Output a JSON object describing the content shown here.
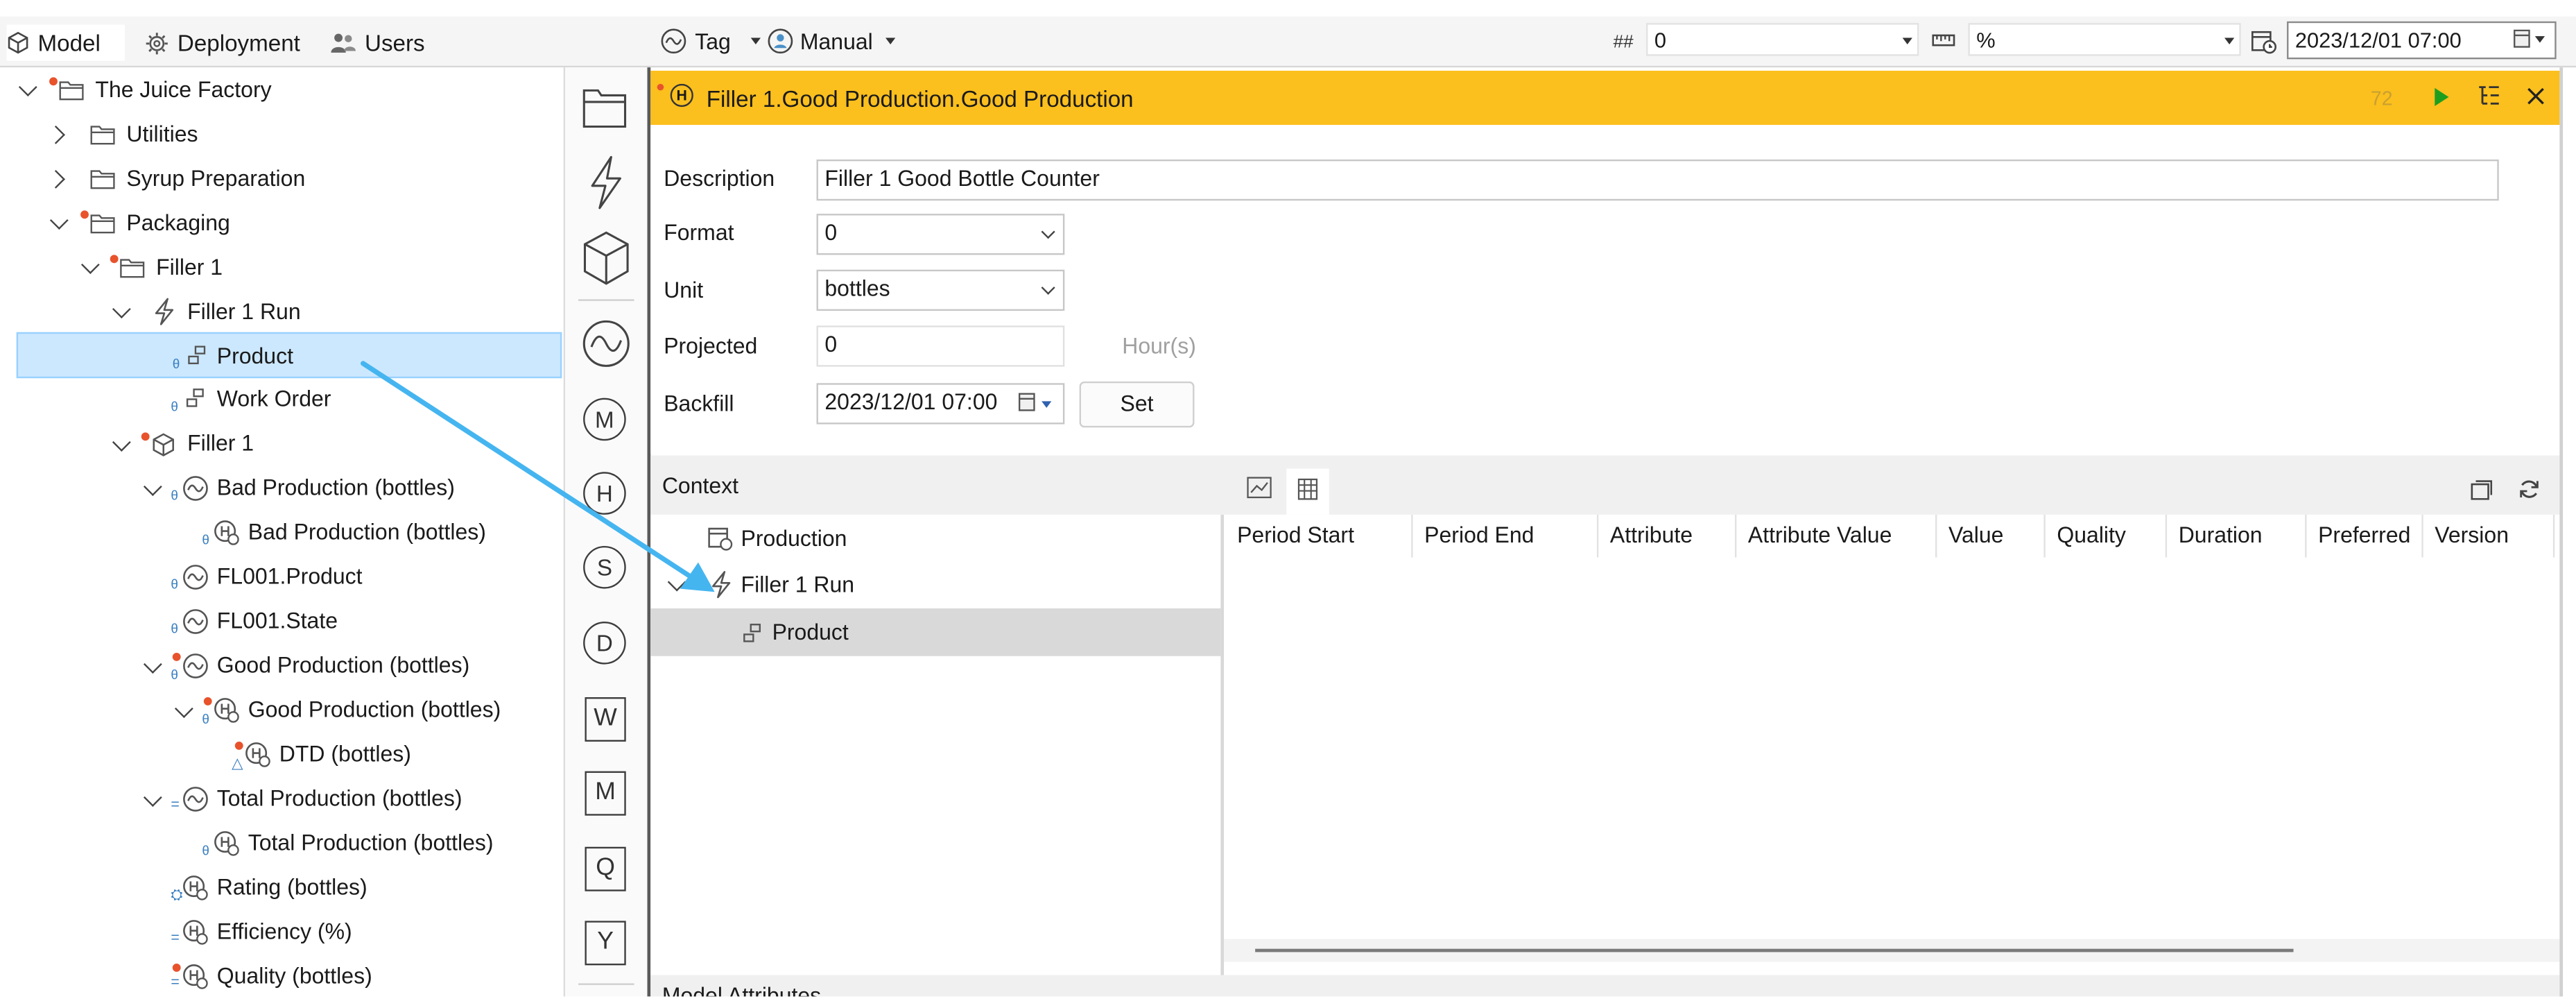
{
  "nav": {
    "tabs": [
      {
        "label": "Model",
        "icon": "cube-icon",
        "active": true
      },
      {
        "label": "Deployment",
        "icon": "gear-icon",
        "active": false
      },
      {
        "label": "Users",
        "icon": "users-icon",
        "active": false
      }
    ]
  },
  "toolbar": {
    "tag_label": "Tag",
    "manual_label": "Manual",
    "format_symbol": "##",
    "format_value": "0",
    "unit_value": "%",
    "datetime_value": "2023/12/01 07:00"
  },
  "tree": {
    "items": [
      {
        "label": "The Juice Factory",
        "icon": "folder-icon"
      },
      {
        "label": "Utilities",
        "icon": "folder-icon"
      },
      {
        "label": "Syrup Preparation",
        "icon": "folder-icon"
      },
      {
        "label": "Packaging",
        "icon": "folder-icon"
      },
      {
        "label": "Filler 1",
        "icon": "folder-icon"
      },
      {
        "label": "Filler 1 Run",
        "icon": "lightning-icon"
      },
      {
        "label": "Product",
        "icon": "attribute-icon"
      },
      {
        "label": "Work Order",
        "icon": "attribute-icon"
      },
      {
        "label": "Filler 1",
        "icon": "asset-icon"
      },
      {
        "label": "Bad Production (bottles)",
        "icon": "wave-icon"
      },
      {
        "label": "Bad Production (bottles)",
        "icon": "history-icon"
      },
      {
        "label": "FL001.Product",
        "icon": "wave-icon"
      },
      {
        "label": "FL001.State",
        "icon": "wave-icon"
      },
      {
        "label": "Good Production (bottles)",
        "icon": "wave-icon"
      },
      {
        "label": "Good Production (bottles)",
        "icon": "history-icon"
      },
      {
        "label": "DTD (bottles)",
        "icon": "history-icon"
      },
      {
        "label": "Total Production (bottles)",
        "icon": "wave-icon"
      },
      {
        "label": "Total Production (bottles)",
        "icon": "history-icon"
      },
      {
        "label": "Rating (bottles)",
        "icon": "history-icon"
      },
      {
        "label": "Efficiency (%)",
        "icon": "history-icon"
      },
      {
        "label": "Quality (bottles)",
        "icon": "history-icon"
      }
    ]
  },
  "strip": {
    "icons": [
      "folder-icon",
      "lightning-icon",
      "cube-icon",
      "wave-icon"
    ],
    "letters_circle": [
      "M",
      "H",
      "S",
      "D"
    ],
    "letters_square": [
      "W",
      "M",
      "Q",
      "Y"
    ]
  },
  "detail": {
    "title": "Filler 1.Good Production.Good Production",
    "count": "72",
    "colors": {
      "header_bg": "#fbbf1e",
      "play": "#1e9e1e",
      "selection": "#cce8ff",
      "arrow": "#45b5f0"
    },
    "form": {
      "description_label": "Description",
      "description_value": "Filler 1 Good Bottle Counter",
      "format_label": "Format",
      "format_value": "0",
      "unit_label": "Unit",
      "unit_value": "bottles",
      "projected_label": "Projected",
      "projected_value": "0",
      "projected_unit": "Hour(s)",
      "backfill_label": "Backfill",
      "backfill_value": "2023/12/01 07:00",
      "set_label": "Set"
    },
    "context": {
      "label": "Context",
      "items": [
        {
          "label": "Production",
          "icon": "calendar-icon"
        },
        {
          "label": "Filler 1 Run",
          "icon": "lightning-icon"
        },
        {
          "label": "Product",
          "icon": "attribute-icon"
        }
      ]
    },
    "table": {
      "columns": [
        "Period Start",
        "Period End",
        "Attribute",
        "Attribute Value",
        "Value",
        "Quality",
        "Duration",
        "Preferred",
        "Version"
      ]
    },
    "footer_label": "Model Attributes"
  }
}
